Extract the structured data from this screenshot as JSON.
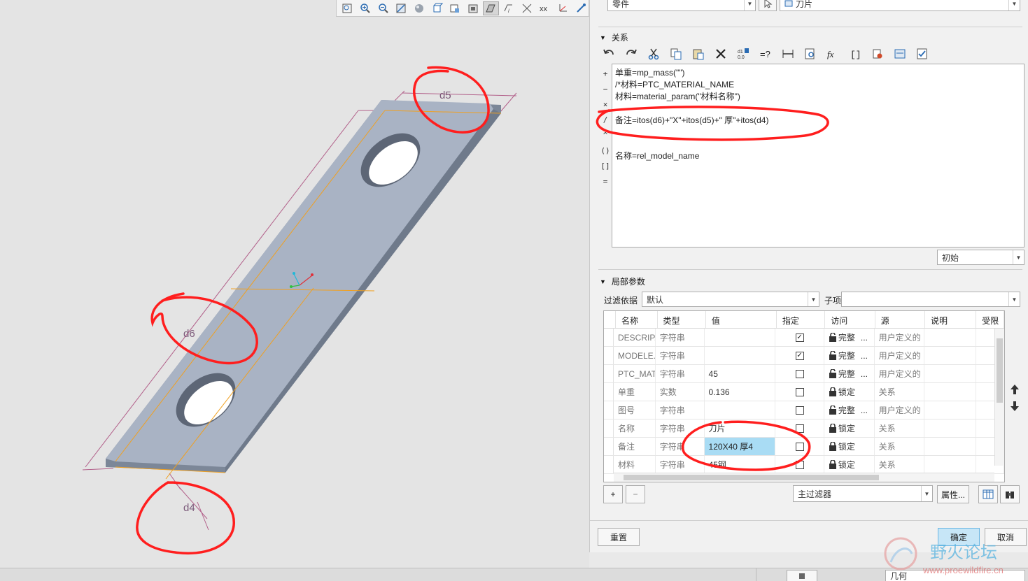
{
  "top_combos": {
    "type_value": "零件",
    "target_value": "刀片"
  },
  "relations": {
    "title": "关系",
    "toolbar_icons": [
      "undo-icon",
      "redo-icon",
      "cut-icon",
      "copy-icon",
      "paste-icon",
      "delete-icon",
      "switch-units-icon",
      "evaluate-icon",
      "dimension-icon",
      "find-icon",
      "insert-function-icon",
      "brackets-icon",
      "parameter-icon",
      "export-icon",
      "verify-icon"
    ],
    "side_ops": [
      "+",
      "−",
      "×",
      "/",
      "^",
      "()",
      "[]",
      "="
    ],
    "lines": [
      "单重=mp_mass(\"\")",
      "/*材料=PTC_MATERIAL_NAME",
      "材料=material_param(\"材料名称\")",
      "",
      "备注=itos(d6)+\"X\"+itos(d5)+\" 厚\"+itos(d4)",
      "",
      "",
      "名称=rel_model_name"
    ],
    "sort_combo": "初始"
  },
  "local_params": {
    "title": "局部参数",
    "filter_label": "过滤依据",
    "filter_value": "默认",
    "subitem_label": "子项",
    "subitem_value": "",
    "columns": [
      "名称",
      "类型",
      "值",
      "指定",
      "访问",
      "源",
      "说明",
      "受限"
    ],
    "rows": [
      {
        "name": "DESCRIP...",
        "type": "字符串",
        "value": "",
        "designated": true,
        "access": "完整",
        "access_dots": "...",
        "source": "用户定义的"
      },
      {
        "name": "MODELE...",
        "type": "字符串",
        "value": "",
        "designated": true,
        "access": "完整",
        "access_dots": "...",
        "source": "用户定义的"
      },
      {
        "name": "PTC_MAT...",
        "type": "字符串",
        "value": "45",
        "designated": false,
        "access": "完整",
        "access_dots": "...",
        "source": "用户定义的"
      },
      {
        "name": "单重",
        "type": "实数",
        "value": "0.136",
        "designated": false,
        "access": "锁定",
        "access_dots": "",
        "source": "关系"
      },
      {
        "name": "图号",
        "type": "字符串",
        "value": "",
        "designated": false,
        "access": "完整",
        "access_dots": "...",
        "source": "用户定义的"
      },
      {
        "name": "名称",
        "type": "字符串",
        "value": "刀片",
        "designated": false,
        "access": "锁定",
        "access_dots": "",
        "source": "关系"
      },
      {
        "name": "备注",
        "type": "字符串",
        "value": "120X40 厚4",
        "designated": false,
        "access": "锁定",
        "access_dots": "",
        "source": "关系",
        "selected": true
      },
      {
        "name": "材料",
        "type": "字符串",
        "value": "45钢",
        "designated": false,
        "access": "锁定",
        "access_dots": "",
        "source": "关系"
      }
    ],
    "add_label": "+",
    "remove_label": "−",
    "main_filter": "主过滤器",
    "properties_label": "属性..."
  },
  "footer": {
    "reset_label": "重置",
    "ok_label": "确定",
    "cancel_label": "取消"
  },
  "model": {
    "dim_labels": [
      "d5",
      "d6",
      "d4"
    ]
  },
  "status": {
    "geometry_filter": "几何"
  },
  "watermark": {
    "title": "野火论坛",
    "url": "www.proewildfire.cn"
  },
  "colors": {
    "part_top": "#a9b3c4",
    "part_side": "#7c8798",
    "annotation_red": "#ff1e1e",
    "datum_orange": "#f0a020",
    "dim_line": "#b2608a",
    "selected_cell": "#a9dcf4"
  }
}
